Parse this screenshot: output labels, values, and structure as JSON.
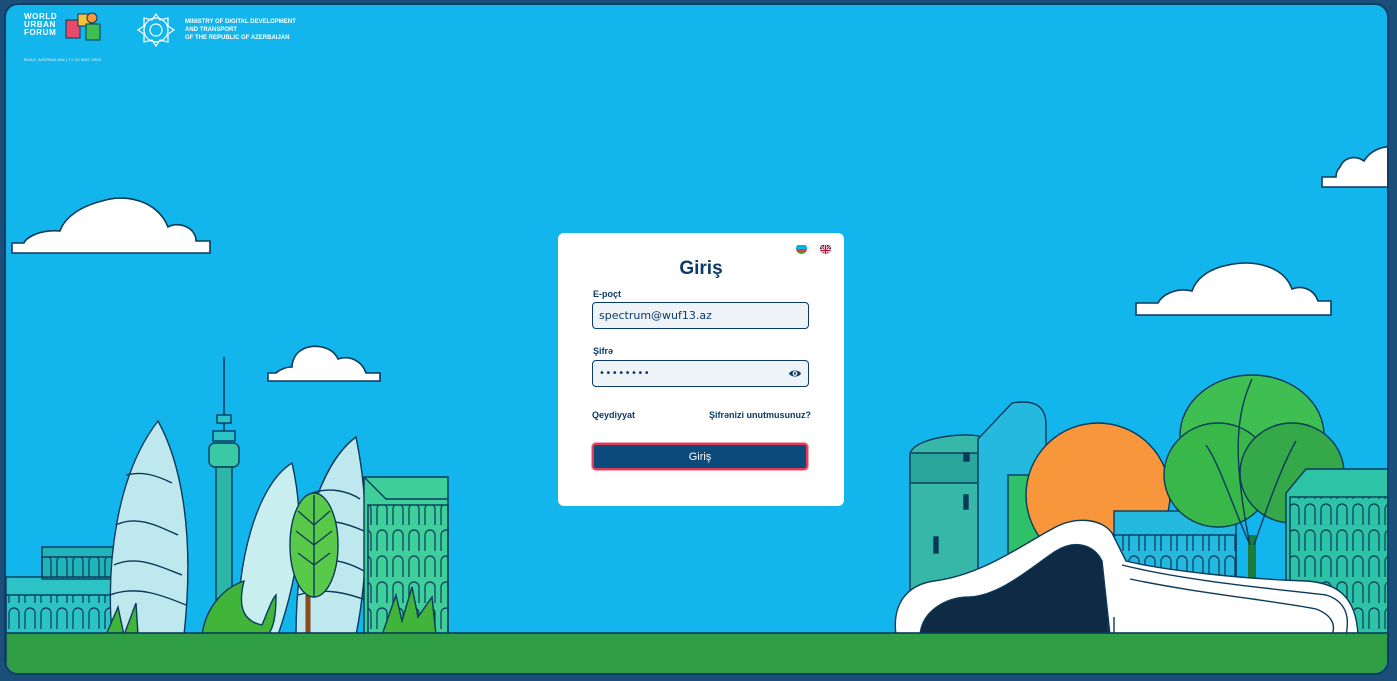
{
  "header": {
    "wuf_logo_lines": [
      "WORLD",
      "URBAN",
      "FORUM"
    ],
    "wuf_subtitle": "BAKU, AZERBAIJAN | 17-22 MAY 2026",
    "ministry_lines": [
      "MINISTRY OF DIGITAL DEVELOPMENT",
      "AND TRANSPORT",
      "OF THE REPUBLIC OF AZERBAIJAN"
    ]
  },
  "login": {
    "title": "Giriş",
    "email_label": "E-poçt",
    "email_value": "spectrum@wuf13.az",
    "password_label": "Şifrə",
    "password_value": "••••••••",
    "register_link": "Qeydiyyat",
    "forgot_link": "Şifrənizi unutmusunuz?",
    "submit_label": "Giriş",
    "languages": [
      "az-flag-icon",
      "uk-flag-icon"
    ]
  },
  "colors": {
    "sky": "#13b6ec",
    "grass": "#2f9e44",
    "primary": "#0b4a7a",
    "focus_border": "#e23b5a"
  }
}
